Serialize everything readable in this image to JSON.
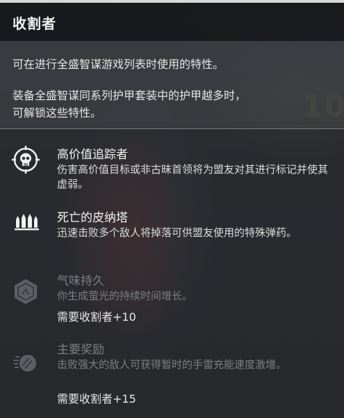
{
  "header": {
    "title": "收割者"
  },
  "description": {
    "line1": "可在进行全盛智谋游戏列表时使用的特性。",
    "line2": "装备全盛智谋同系列护甲套装中的护甲越多时，",
    "line3": "可解锁这些特性。"
  },
  "background": {
    "number_fragment": "10"
  },
  "perks": [
    {
      "name": "高价值追踪者",
      "desc": "伤害高价值目标或非古昧首领将为盟友对其进行标记并使其虚弱。",
      "icon": "skull-target-icon",
      "locked": false
    },
    {
      "name": "死亡的皮纳塔",
      "desc": "迅速击败多个敌人将掉落可供盟友使用的特殊弹药。",
      "icon": "ammo-bricks-icon",
      "locked": false
    },
    {
      "name": "气味持久",
      "desc": "你生成萤光的持续时间增长。",
      "requirement": "需要收割者+10",
      "icon": "hex-shield-icon",
      "locked": true
    },
    {
      "name": "主要奖励",
      "desc": "击败强大的敌人可获得暂时的手雷充能速度激增。",
      "requirement": "需要收割者+15",
      "icon": "grenade-icon",
      "locked": true
    }
  ],
  "colors": {
    "header_bg": "#161719",
    "header_border": "#d9d9d9",
    "text_active": "#f4f4f4",
    "text_locked": "#7d7f83"
  }
}
